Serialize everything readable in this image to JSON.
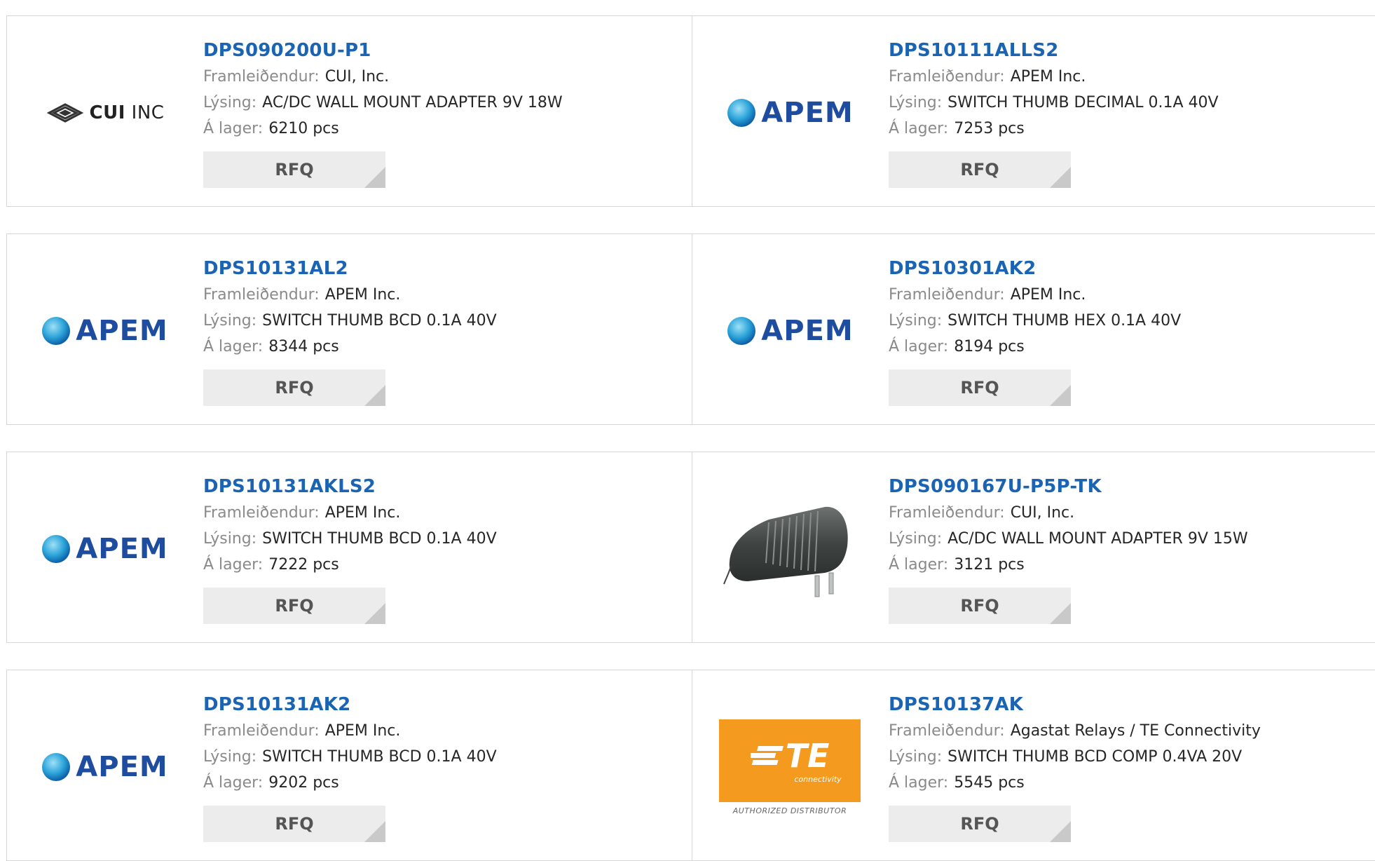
{
  "labels": {
    "manufacturer": "Framleiðendur:",
    "description": "Lýsing:",
    "stock": "Á lager:",
    "rfq": "RFQ"
  },
  "products": [
    {
      "part": "DPS090200U-P1",
      "manufacturer": "CUI, Inc.",
      "description": "AC/DC WALL MOUNT ADAPTER 9V 18W",
      "stock": "6210 pcs",
      "logo": "cui-logo"
    },
    {
      "part": "DPS10111ALLS2",
      "manufacturer": "APEM Inc.",
      "description": "SWITCH THUMB DECIMAL 0.1A 40V",
      "stock": "7253 pcs",
      "logo": "apem-logo"
    },
    {
      "part": "DPS10131AL2",
      "manufacturer": "APEM Inc.",
      "description": "SWITCH THUMB BCD 0.1A 40V",
      "stock": "8344 pcs",
      "logo": "apem-logo"
    },
    {
      "part": "DPS10301AK2",
      "manufacturer": "APEM Inc.",
      "description": "SWITCH THUMB HEX 0.1A 40V",
      "stock": "8194 pcs",
      "logo": "apem-logo"
    },
    {
      "part": "DPS10131AKLS2",
      "manufacturer": "APEM Inc.",
      "description": "SWITCH THUMB BCD 0.1A 40V",
      "stock": "7222 pcs",
      "logo": "apem-logo"
    },
    {
      "part": "DPS090167U-P5P-TK",
      "manufacturer": "CUI, Inc.",
      "description": "AC/DC WALL MOUNT ADAPTER 9V 15W",
      "stock": "3121 pcs",
      "logo": "wall-adapter-photo"
    },
    {
      "part": "DPS10131AK2",
      "manufacturer": "APEM Inc.",
      "description": "SWITCH THUMB BCD 0.1A 40V",
      "stock": "9202 pcs",
      "logo": "apem-logo"
    },
    {
      "part": "DPS10137AK",
      "manufacturer": "Agastat Relays / TE Connectivity",
      "description": "SWITCH THUMB BCD COMP 0.4VA 20V",
      "stock": "5545 pcs",
      "logo": "te-logo"
    }
  ],
  "logos": {
    "apem": "APEM",
    "cui_bold": "CUI",
    "cui_light": "INC",
    "te": "TE",
    "te_sub": "connectivity",
    "te_caption": "AUTHORIZED DISTRIBUTOR"
  },
  "colors": {
    "part_link": "#1b64b4",
    "label": "#8a8a8a",
    "value": "#262626",
    "rfq_bg": "#ececec",
    "te_orange": "#f39a1f",
    "apem_blue": "#1e4c9e"
  }
}
